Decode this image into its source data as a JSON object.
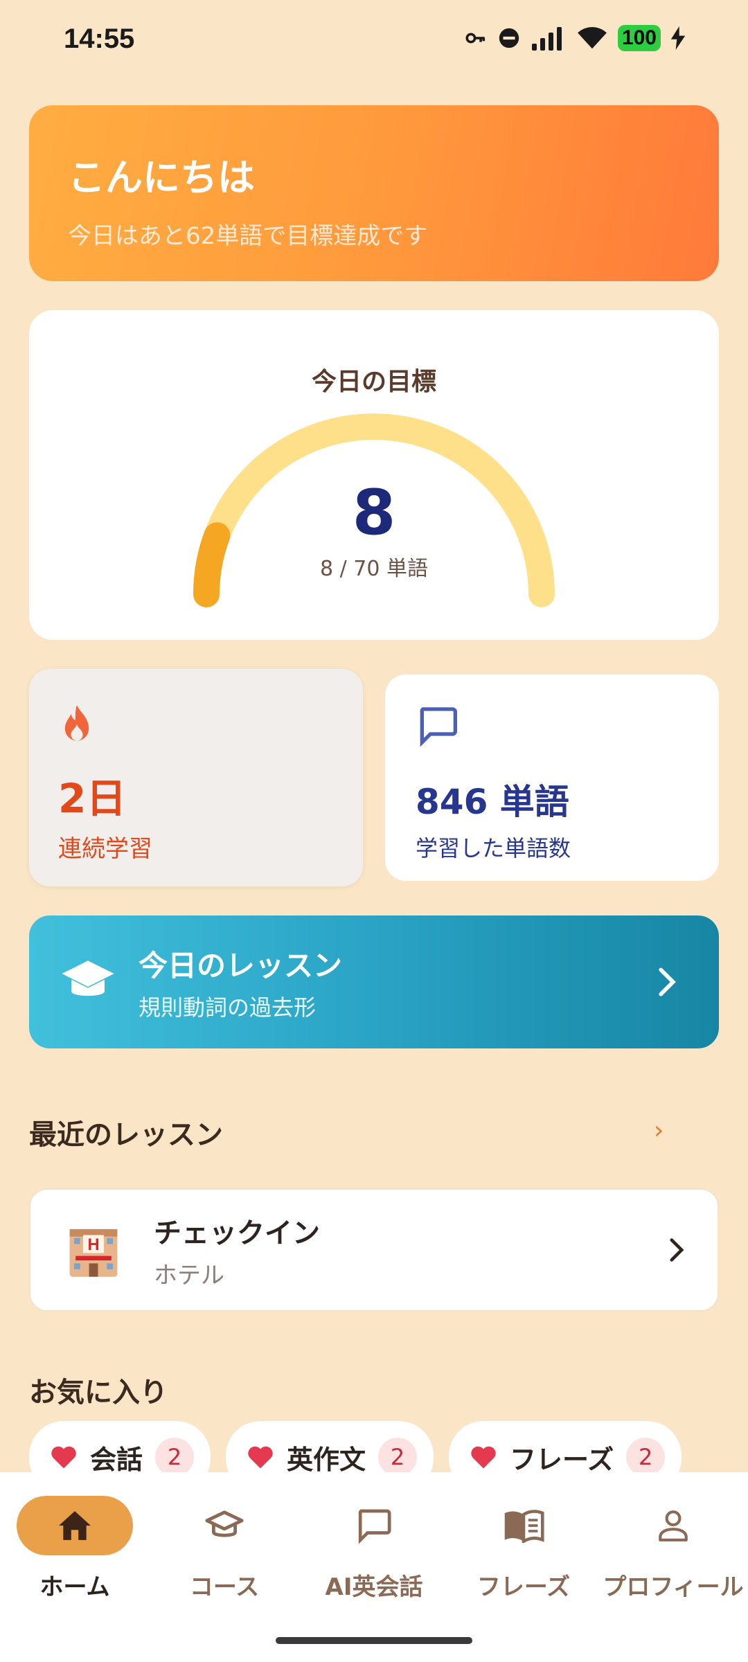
{
  "status_bar": {
    "time": "14:55",
    "battery": "100",
    "icons": [
      "key-icon",
      "do-not-disturb-icon",
      "signal-icon",
      "wifi-icon",
      "battery-icon",
      "charging-icon"
    ]
  },
  "greeting": {
    "title": "こんにちは",
    "subtitle": "今日はあと62単語で目標達成です"
  },
  "goal": {
    "title": "今日の目標",
    "value": "8",
    "progress_text": "8 / 70 単語",
    "progress_fraction": 0.114
  },
  "stats": {
    "streak": {
      "icon": "fire-icon",
      "value": "2日",
      "label": "連続学習"
    },
    "words": {
      "icon": "chat-bubble-icon",
      "value": "846 単語",
      "label": "学習した単語数"
    }
  },
  "today_lesson": {
    "icon": "graduation-cap-icon",
    "title": "今日のレッスン",
    "subtitle": "規則動詞の過去形"
  },
  "recent": {
    "title": "最近のレッスン",
    "more": "›",
    "items": [
      {
        "icon": "hotel-icon",
        "title": "チェックイン",
        "subtitle": "ホテル"
      }
    ]
  },
  "favorites": {
    "title": "お気に入り",
    "chips": [
      {
        "label": "会話",
        "count": "2"
      },
      {
        "label": "英作文",
        "count": "2"
      },
      {
        "label": "フレーズ",
        "count": "2"
      }
    ]
  },
  "nav": {
    "items": [
      {
        "label": "ホーム",
        "icon": "home-icon",
        "active": true
      },
      {
        "label": "コース",
        "icon": "graduation-cap-icon",
        "active": false
      },
      {
        "label": "AI英会話",
        "icon": "chat-bubble-icon",
        "active": false
      },
      {
        "label": "フレーズ",
        "icon": "book-icon",
        "active": false
      },
      {
        "label": "プロフィール",
        "icon": "person-icon",
        "active": false
      }
    ]
  },
  "colors": {
    "background": "#fae5c6",
    "accent_orange": "#ff9a3c",
    "lesson_teal": "#2aa3c5",
    "streak_red": "#e2491a",
    "words_blue": "#27368f",
    "gauge_track": "#ffe08a",
    "gauge_fill": "#f5a623"
  }
}
